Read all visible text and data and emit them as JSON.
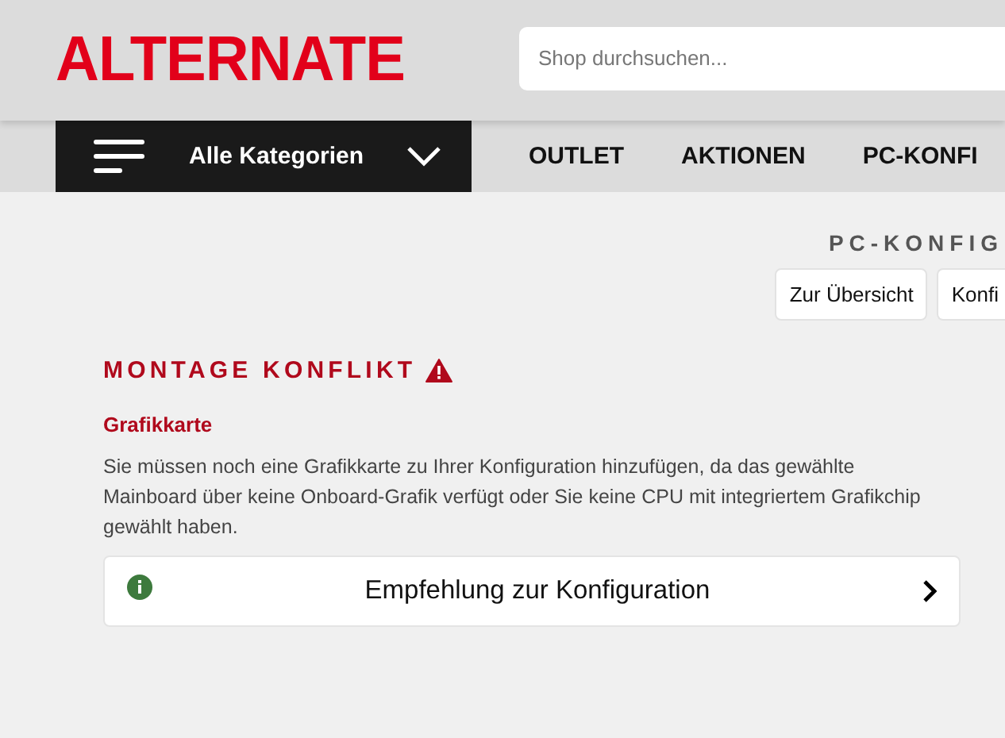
{
  "header": {
    "logo": "ALTERNATE",
    "search": {
      "placeholder": "Shop durchsuchen..."
    }
  },
  "nav": {
    "categories": "Alle Kategorien",
    "links": [
      "OUTLET",
      "AKTIONEN",
      "PC-KONFI"
    ]
  },
  "page_title": "PC-KONFIG",
  "actions": [
    "Zur Übersicht",
    "Konfi"
  ],
  "conflict": {
    "title": "MONTAGE KONFLIKT",
    "component": "Grafikkarte",
    "message": "Sie müssen noch eine Grafikkarte zu Ihrer Konfiguration hinzufügen, da das gewählte Mainboard über keine Onboard-Grafik verfügt oder Sie keine CPU mit integriertem Grafikchip gewählt haben.",
    "recommendation": "Empfehlung zur Konfiguration"
  }
}
